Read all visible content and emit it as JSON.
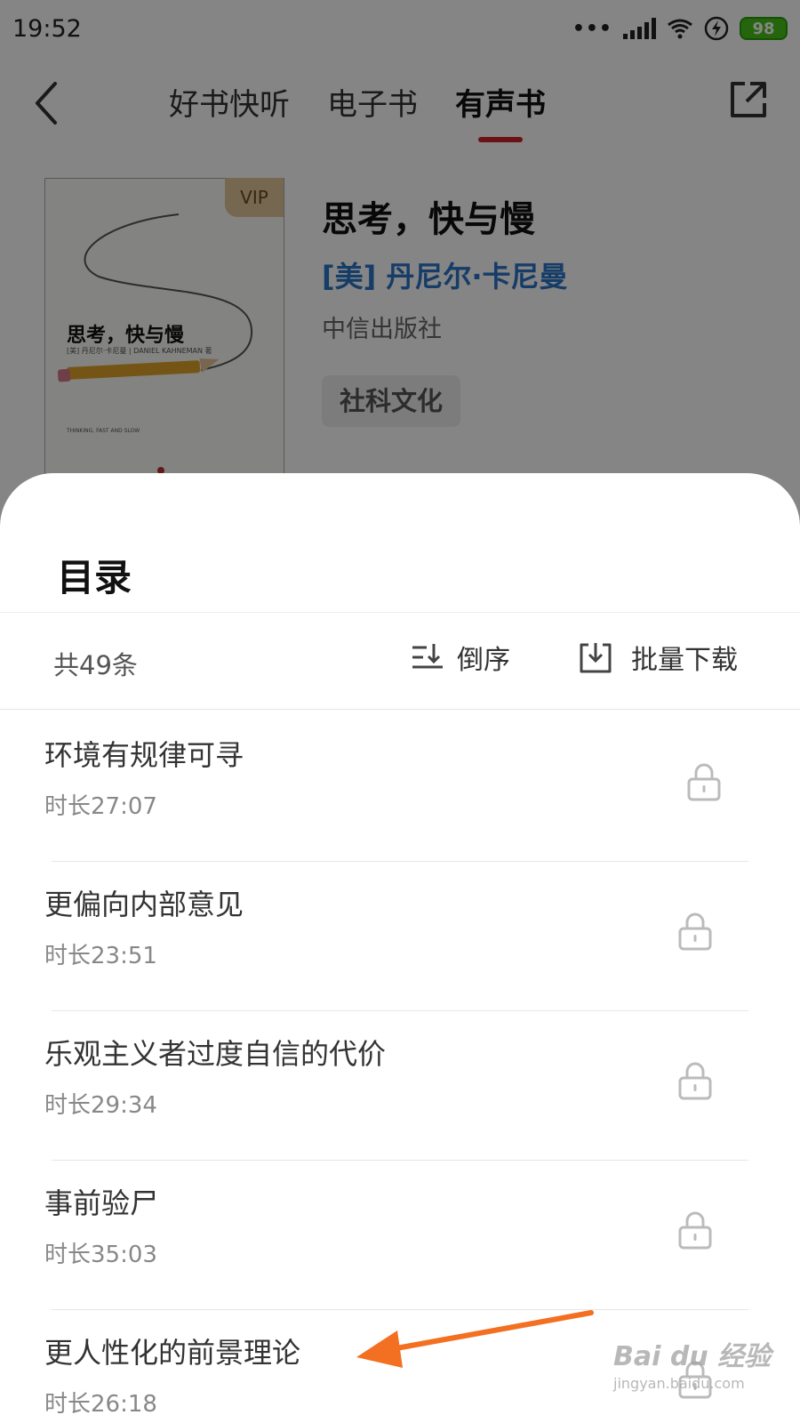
{
  "status_bar": {
    "time": "19:52",
    "signal_dots": "•••",
    "battery": "98",
    "battery_color": "#48c21a"
  },
  "nav": {
    "back_icon": "chevron-left-icon",
    "tabs": [
      {
        "label": "好书快听",
        "active": false
      },
      {
        "label": "电子书",
        "active": false
      },
      {
        "label": "有声书",
        "active": true
      }
    ],
    "share_icon": "share-icon",
    "active_underline_color": "#d0212a"
  },
  "book": {
    "cover_title": "思考，快与慢",
    "cover_line1": "[美] 丹尼尔·卡尼曼 | DANIEL KAHNEMAN 著",
    "cover_line2": "THINKING, FAST AND SLOW",
    "vip": "VIP",
    "title": "思考，快与慢",
    "author": "[美] 丹尼尔·卡尼曼",
    "author_color": "#2b73c8",
    "publisher": "中信出版社",
    "tag": "社科文化"
  },
  "sheet": {
    "title": "目录",
    "count": "共49条",
    "sort_label": "倒序",
    "sort_icon": "sort-reverse-icon",
    "download_label": "批量下载",
    "download_icon": "download-icon",
    "chapters": [
      {
        "title": "环境有规律可寻",
        "duration": "时长27:07",
        "locked": true
      },
      {
        "title": "更偏向内部意见",
        "duration": "时长23:51",
        "locked": true
      },
      {
        "title": "乐观主义者过度自信的代价",
        "duration": "时长29:34",
        "locked": true
      },
      {
        "title": "事前验尸",
        "duration": "时长35:03",
        "locked": true
      },
      {
        "title": "更人性化的前景理论",
        "duration": "时长26:18",
        "locked": true
      }
    ]
  },
  "annotation": {
    "arrow_color": "#f36f21"
  },
  "watermark": {
    "main": "Bai du 经验",
    "sub": "jingyan.baidu.com"
  }
}
